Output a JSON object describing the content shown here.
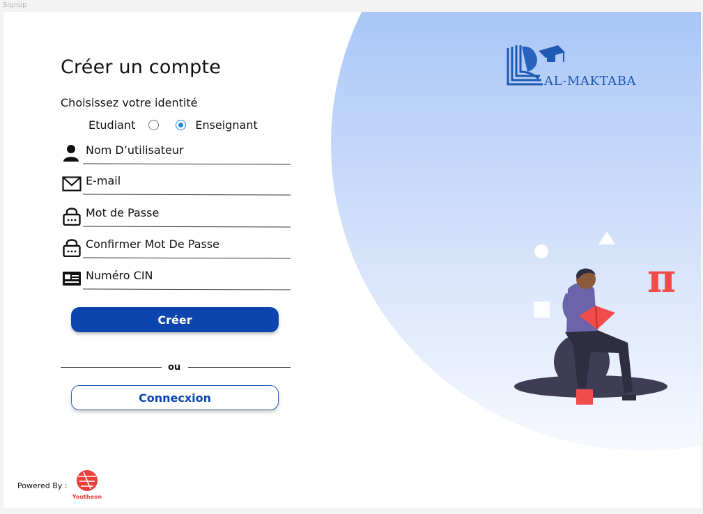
{
  "frame": {
    "label": "Signup"
  },
  "form": {
    "title": "Créer un compte",
    "identity_prompt": "Choisissez votre identité",
    "roles": [
      {
        "label": "Etudiant",
        "selected": false
      },
      {
        "label": "Enseignant",
        "selected": true
      }
    ],
    "fields": {
      "username": {
        "placeholder": "Nom D’utilisateur",
        "icon": "user-icon"
      },
      "email": {
        "placeholder": "E-mail",
        "icon": "envelope-icon"
      },
      "password": {
        "placeholder": "Mot de Passe",
        "icon": "lock-icon"
      },
      "confirm_password": {
        "placeholder": "Confirmer Mot De Passe",
        "icon": "lock-icon"
      },
      "cin": {
        "placeholder": "Numéro CIN",
        "icon": "id-card-icon"
      }
    },
    "create_button": "Créer",
    "separator": "ou",
    "login_button": "Connecxion"
  },
  "footer": {
    "powered_by": "Powered By :",
    "brand": "Youtheon",
    "brand_color": "#e8413c"
  },
  "logo": {
    "name": "AL-MAKTABA",
    "color": "#1f5ab2"
  },
  "colors": {
    "primary": "#0b45ad",
    "radio_selected": "#1e88e5",
    "accent_red": "#f04c4c",
    "blob_top": "#86b0f5"
  }
}
